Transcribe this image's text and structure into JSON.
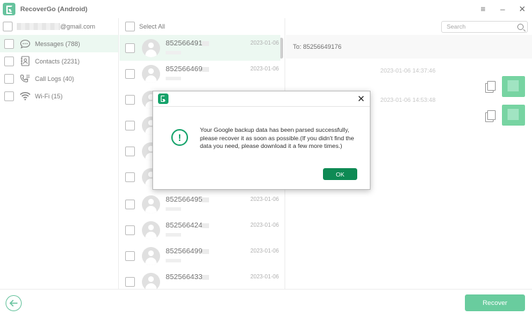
{
  "window": {
    "title": "RecoverGo (Android)",
    "controls": [
      {
        "name": "menu-icon",
        "glyph": "≡"
      },
      {
        "name": "minimize-icon",
        "glyph": "–"
      },
      {
        "name": "close-icon",
        "glyph": "✕"
      }
    ]
  },
  "account": {
    "email_domain": "@gmail.com"
  },
  "categories": [
    {
      "label": "Messages (788)",
      "icon": "messages-icon"
    },
    {
      "label": "Contacts (2231)",
      "icon": "contacts-icon"
    },
    {
      "label": "Call Logs (40)",
      "icon": "call-logs-icon"
    },
    {
      "label": "Wi-Fi (15)",
      "icon": "wifi-icon"
    }
  ],
  "list": {
    "select_all_label": "Select All",
    "items": [
      {
        "number": "852566491",
        "date": "2023-01-06"
      },
      {
        "number": "852566469",
        "date": "2023-01-06"
      },
      {
        "number": "",
        "date": ""
      },
      {
        "number": "",
        "date": ""
      },
      {
        "number": "",
        "date": ""
      },
      {
        "number": "",
        "date": ""
      },
      {
        "number": "852566495",
        "date": "2023-01-06"
      },
      {
        "number": "852566424",
        "date": "2023-01-06"
      },
      {
        "number": "852566499",
        "date": "2023-01-06"
      },
      {
        "number": "852566433",
        "date": "2023-01-06"
      }
    ]
  },
  "detail": {
    "search_placeholder": "Search",
    "to_label": "To: 85256649176",
    "messages": [
      {
        "time": "2023-01-06 14:37:46"
      },
      {
        "time": "2023-01-06 14:53:48"
      }
    ]
  },
  "footer": {
    "recover_label": "Recover"
  },
  "dialog": {
    "message": "Your Google backup data has been parsed successfully, please recover it as soon as possible.(If you didn't find the data you need, please download it a few more times.)",
    "ok_label": "OK",
    "alert_glyph": "!"
  },
  "colors": {
    "brand": "#16a36b",
    "button": "#19b16b",
    "selected_row": "#e2f4ea"
  }
}
